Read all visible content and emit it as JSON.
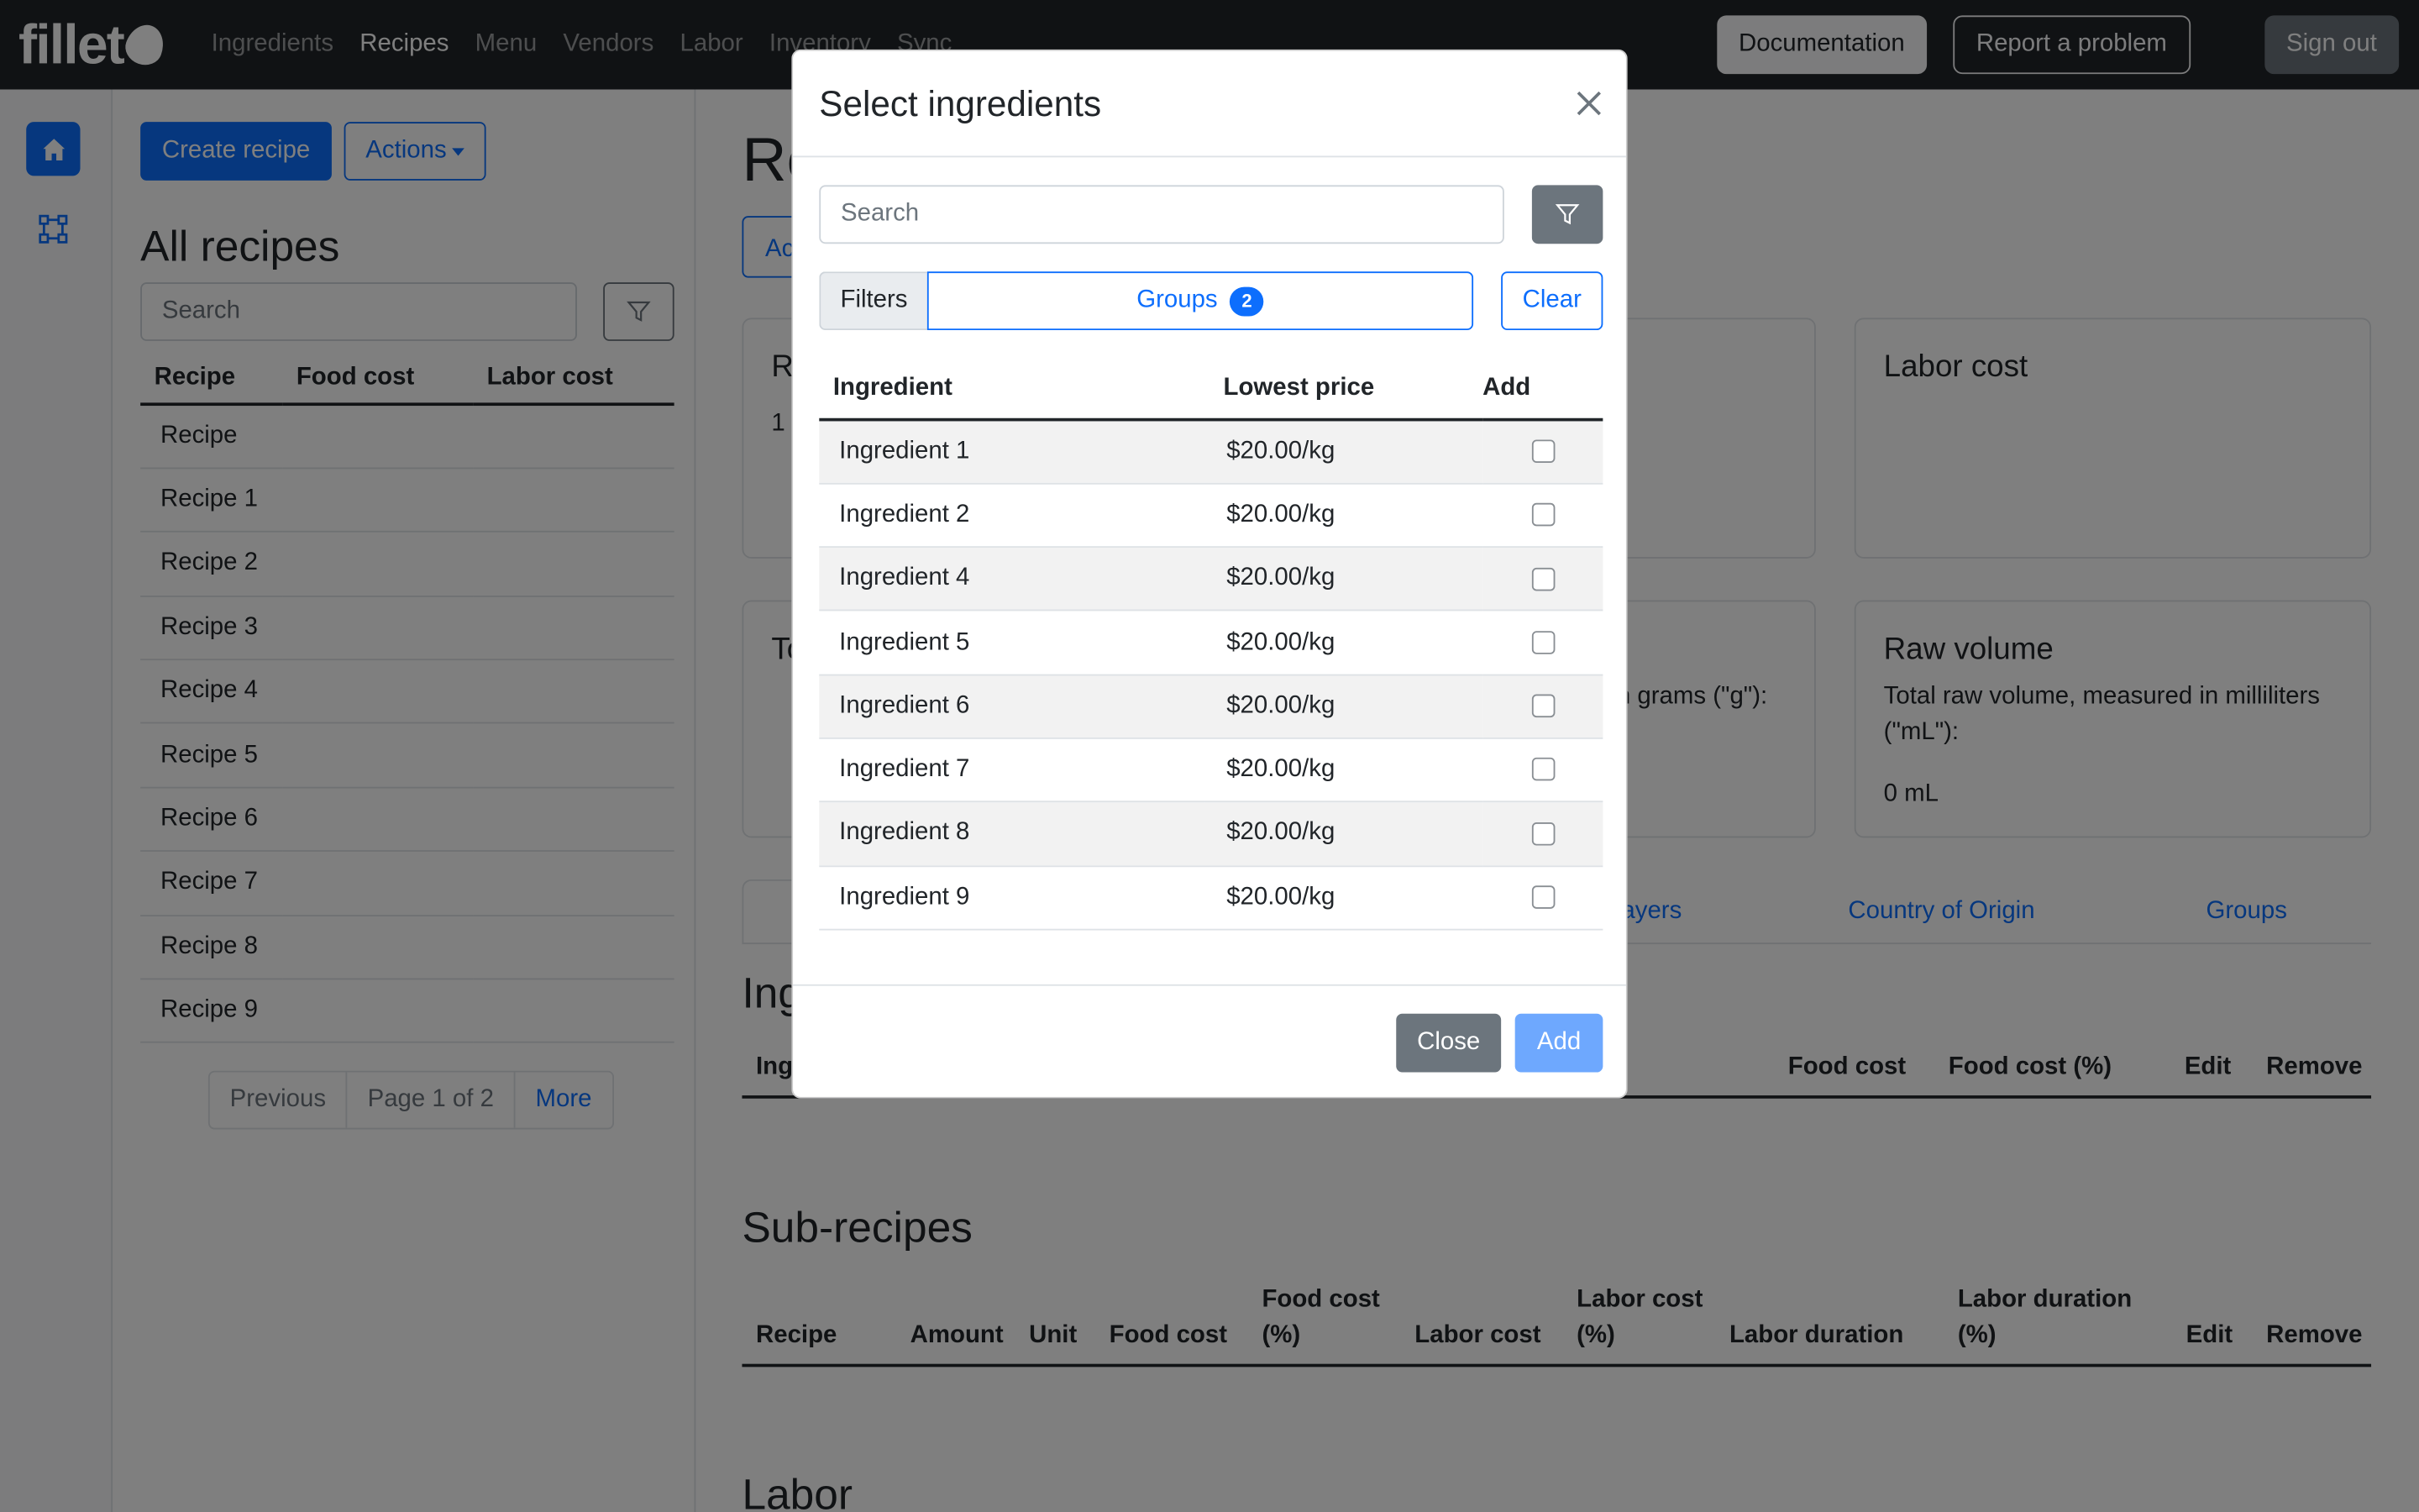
{
  "brand": {
    "name": "fillet"
  },
  "nav": {
    "links": [
      "Ingredients",
      "Recipes",
      "Menu",
      "Vendors",
      "Labor",
      "Inventory",
      "Sync"
    ],
    "active": "Recipes",
    "documentation": "Documentation",
    "report": "Report a problem",
    "signout": "Sign out"
  },
  "sidebar": {
    "items": [
      "home-icon",
      "diagram-icon"
    ]
  },
  "recipes_panel": {
    "create_label": "Create recipe",
    "actions_label": "Actions",
    "title": "All recipes",
    "search_placeholder": "Search",
    "columns": [
      "Recipe",
      "Food cost",
      "Labor cost"
    ],
    "rows": [
      "Recipe",
      "Recipe 1",
      "Recipe 2",
      "Recipe 3",
      "Recipe 4",
      "Recipe 5",
      "Recipe 6",
      "Recipe 7",
      "Recipe 8",
      "Recipe 9"
    ],
    "pager": {
      "previous": "Previous",
      "page": "Page 1 of 2",
      "more": "More"
    }
  },
  "main": {
    "title_partial": "Re",
    "button_partial": "Ac",
    "card_recipe_partial": "R",
    "card_recipe_value_partial": "1",
    "card_total_partial": "To",
    "labor_cost_title": "Labor cost",
    "raw_weight_text_partial": "n grams (\"g\"):",
    "raw_volume": {
      "title": "Raw volume",
      "description": "Total raw volume, measured in milliliters (\"mL\"):",
      "value": "0 mL"
    },
    "tabs": [
      "ayers",
      "Country of Origin",
      "Groups"
    ],
    "ingredients_title_partial": "Ing",
    "ingredients_columns_partial": {
      "first": "Ing",
      "food_cost": "Food cost",
      "food_cost_pct": "Food cost (%)",
      "edit": "Edit",
      "remove": "Remove"
    },
    "subrecipes": {
      "title": "Sub-recipes",
      "columns": {
        "recipe": "Recipe",
        "amount": "Amount",
        "unit": "Unit",
        "food_cost": "Food cost",
        "food_cost_pct_1": "Food cost",
        "food_cost_pct_2": "(%)",
        "labor_cost": "Labor cost",
        "labor_cost_pct_1": "Labor cost",
        "labor_cost_pct_2": "(%)",
        "labor_duration": "Labor duration",
        "labor_duration_pct_1": "Labor duration",
        "labor_duration_pct_2": "(%)",
        "edit": "Edit",
        "remove": "Remove"
      }
    },
    "labor_title": "Labor"
  },
  "modal": {
    "title": "Select ingredients",
    "search_placeholder": "Search",
    "filters_label": "Filters",
    "groups_label": "Groups",
    "groups_count": "2",
    "clear_label": "Clear",
    "columns": {
      "ingredient": "Ingredient",
      "price": "Lowest price",
      "add": "Add"
    },
    "rows": [
      {
        "name": "Ingredient 1",
        "price": "$20.00/kg",
        "checked": false
      },
      {
        "name": "Ingredient 2",
        "price": "$20.00/kg",
        "checked": false
      },
      {
        "name": "Ingredient 4",
        "price": "$20.00/kg",
        "checked": false
      },
      {
        "name": "Ingredient 5",
        "price": "$20.00/kg",
        "checked": false
      },
      {
        "name": "Ingredient 6",
        "price": "$20.00/kg",
        "checked": false
      },
      {
        "name": "Ingredient 7",
        "price": "$20.00/kg",
        "checked": false
      },
      {
        "name": "Ingredient 8",
        "price": "$20.00/kg",
        "checked": false
      },
      {
        "name": "Ingredient 9",
        "price": "$20.00/kg",
        "checked": false
      }
    ],
    "close_label": "Close",
    "add_label": "Add"
  },
  "colors": {
    "primary": "#0d6efd",
    "secondary": "#6c757d",
    "dark": "#212529",
    "primary_disabled": "#6ea8fe"
  }
}
